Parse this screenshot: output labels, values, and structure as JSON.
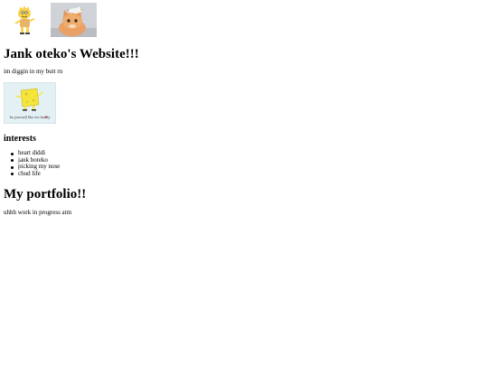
{
  "header": {
    "images": [
      {
        "name": "cartoon-character-image"
      },
      {
        "name": "cat-with-bird-image"
      }
    ]
  },
  "main": {
    "title": "Jank oteko's Website!!!",
    "tagline": "im diggin in my butt rn",
    "feature_image": {
      "caption": "be yourself like me buddy"
    },
    "interests": {
      "heading": "interests",
      "items": [
        "heart diddi",
        "jank boteko",
        "picking my nose",
        "chud life"
      ]
    },
    "portfolio": {
      "heading": "My portfolio!!",
      "text": "uhhh work in progress atm"
    }
  },
  "colors": {
    "background": "#ffffff",
    "text": "#000000"
  }
}
